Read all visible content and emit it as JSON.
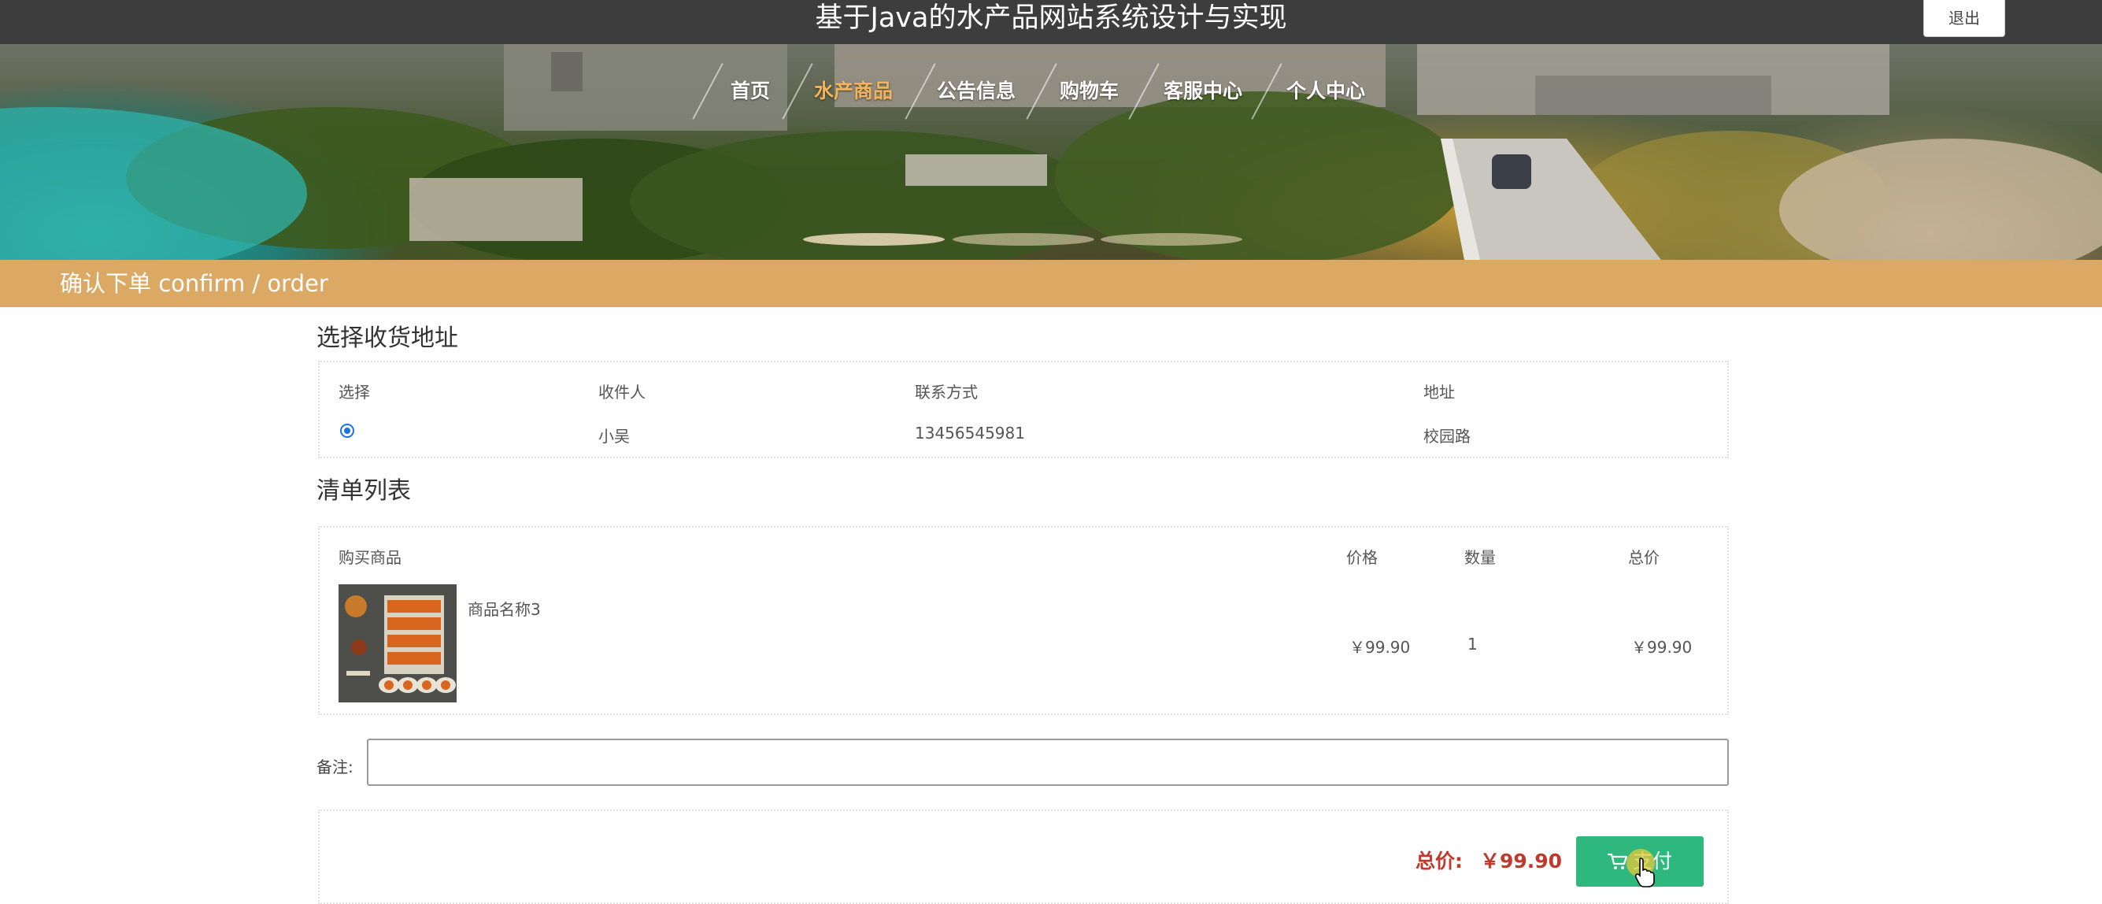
{
  "header": {
    "site_title": "基于Java的水产品网站系统设计与实现",
    "logout_label": "退出"
  },
  "nav": {
    "items": [
      {
        "label": "首页",
        "active": false
      },
      {
        "label": "水产商品",
        "active": true
      },
      {
        "label": "公告信息",
        "active": false
      },
      {
        "label": "购物车",
        "active": false
      },
      {
        "label": "客服中心",
        "active": false
      },
      {
        "label": "个人中心",
        "active": false
      }
    ],
    "active_color": "#f2b45a"
  },
  "banner": {
    "slide_count": 3,
    "active_slide": 1
  },
  "section": {
    "title": "确认下单  confirm / order",
    "bar_color": "#dba963"
  },
  "address": {
    "heading": "选择收货地址",
    "columns": [
      "选择",
      "收件人",
      "联系方式",
      "地址"
    ],
    "rows": [
      {
        "selected": true,
        "recipient": "小吴",
        "phone": "13456545981",
        "address": "校园路"
      }
    ]
  },
  "order_list": {
    "heading": "清单列表",
    "columns": [
      "购买商品",
      "价格",
      "数量",
      "总价"
    ],
    "items": [
      {
        "name": "商品名称3",
        "price": "￥99.90",
        "quantity": "1",
        "subtotal": "￥99.90",
        "image_icon": "seafood-platter-image"
      }
    ]
  },
  "remark": {
    "label": "备注:",
    "value": "",
    "placeholder": ""
  },
  "footer": {
    "total_label": "总价:",
    "total_value": "￥99.90",
    "pay_label": "支付",
    "pay_icon": "cart-icon",
    "pay_color": "#2fb87e",
    "total_color": "#c0392b"
  }
}
